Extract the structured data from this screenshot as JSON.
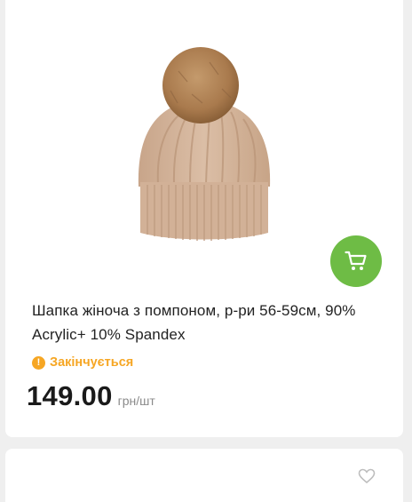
{
  "product": {
    "title": "Шапка жіноча з помпоном, р-ри 56-59см, 90% Acrylic+ 10% Spandex",
    "status": "Закінчується",
    "price": "149.00",
    "unit": "грн/шт",
    "image_icon": "knit-beanie-with-pompom",
    "cart_icon": "shopping-cart-icon"
  },
  "colors": {
    "accent": "#6ebc45",
    "status": "#f6a623",
    "background": "#efefef"
  }
}
